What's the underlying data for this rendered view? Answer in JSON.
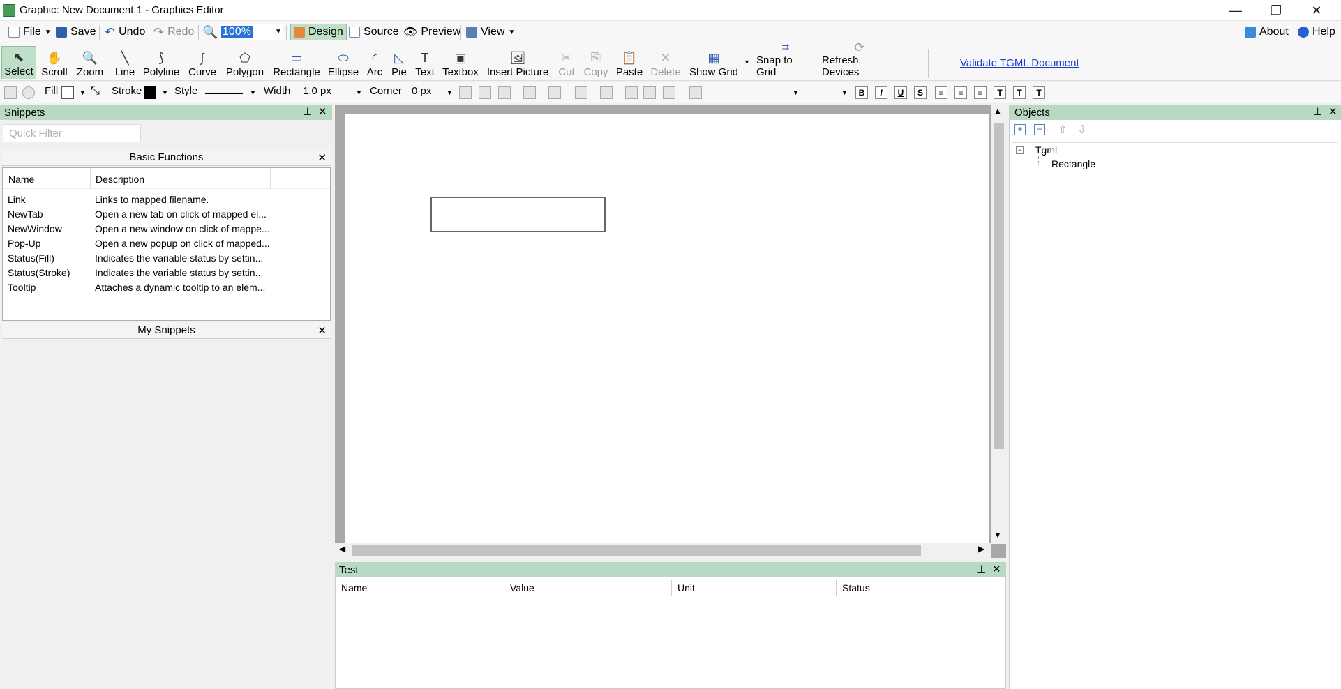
{
  "window": {
    "title": "Graphic: New Document 1 - Graphics Editor",
    "minimize": "—",
    "restore": "❐",
    "close": "✕"
  },
  "menubar": {
    "file": "File",
    "save": "Save",
    "undo": "Undo",
    "redo": "Redo",
    "zoom": "100%",
    "design": "Design",
    "source": "Source",
    "preview": "Preview",
    "view": "View",
    "about": "About",
    "help": "Help"
  },
  "tools": [
    {
      "label": "Select",
      "glyph": "⬉"
    },
    {
      "label": "Scroll",
      "glyph": "✋"
    },
    {
      "label": "Zoom",
      "glyph": "🔍"
    },
    {
      "label": "Line",
      "glyph": "╲"
    },
    {
      "label": "Polyline",
      "glyph": "⟆"
    },
    {
      "label": "Curve",
      "glyph": "∫"
    },
    {
      "label": "Polygon",
      "glyph": "⬠"
    },
    {
      "label": "Rectangle",
      "glyph": "▭"
    },
    {
      "label": "Ellipse",
      "glyph": "⬭"
    },
    {
      "label": "Arc",
      "glyph": "◜"
    },
    {
      "label": "Pie",
      "glyph": "◺"
    },
    {
      "label": "Text",
      "glyph": "T"
    },
    {
      "label": "Textbox",
      "glyph": "▣"
    },
    {
      "label": "Insert Picture",
      "glyph": "🖼"
    },
    {
      "label": "Cut",
      "glyph": "✂"
    },
    {
      "label": "Copy",
      "glyph": "⎘"
    },
    {
      "label": "Paste",
      "glyph": "📋"
    },
    {
      "label": "Delete",
      "glyph": "✕"
    },
    {
      "label": "Show Grid",
      "glyph": "▦"
    },
    {
      "label": "Snap to Grid",
      "glyph": "⌗"
    },
    {
      "label": "Refresh Devices",
      "glyph": "⟳"
    }
  ],
  "validate_link": "Validate TGML Document",
  "format": {
    "fill_label": "Fill",
    "stroke_label": "Stroke",
    "style_label": "Style",
    "width_label": "Width",
    "width_value": "1.0 px",
    "corner_label": "Corner",
    "corner_value": "0 px",
    "stroke_color": "#000000",
    "fill_color": "#ffffff"
  },
  "snippets": {
    "title": "Snippets",
    "filter_placeholder": "Quick Filter",
    "group1": "Basic Functions",
    "group2": "My Snippets",
    "columns": [
      "Name",
      "Description"
    ],
    "rows": [
      {
        "name": "Link",
        "desc": "Links to mapped filename."
      },
      {
        "name": "NewTab",
        "desc": "Open a new tab on click of mapped el..."
      },
      {
        "name": "NewWindow",
        "desc": "Open a new window on click of mappe..."
      },
      {
        "name": "Pop-Up",
        "desc": "Open a new popup on click of mapped..."
      },
      {
        "name": "Status(Fill)",
        "desc": "Indicates the variable status by settin..."
      },
      {
        "name": "Status(Stroke)",
        "desc": "Indicates the variable status by settin..."
      },
      {
        "name": "Tooltip",
        "desc": "Attaches a dynamic tooltip to an elem..."
      }
    ]
  },
  "test": {
    "title": "Test",
    "columns": [
      "Name",
      "Value",
      "Unit",
      "Status"
    ]
  },
  "objects": {
    "title": "Objects",
    "root": "Tgml",
    "child": "Rectangle"
  },
  "colors": {
    "panel_header": "#b8d9c2",
    "active": "#bfe0c8",
    "link": "#1a3dcc"
  }
}
